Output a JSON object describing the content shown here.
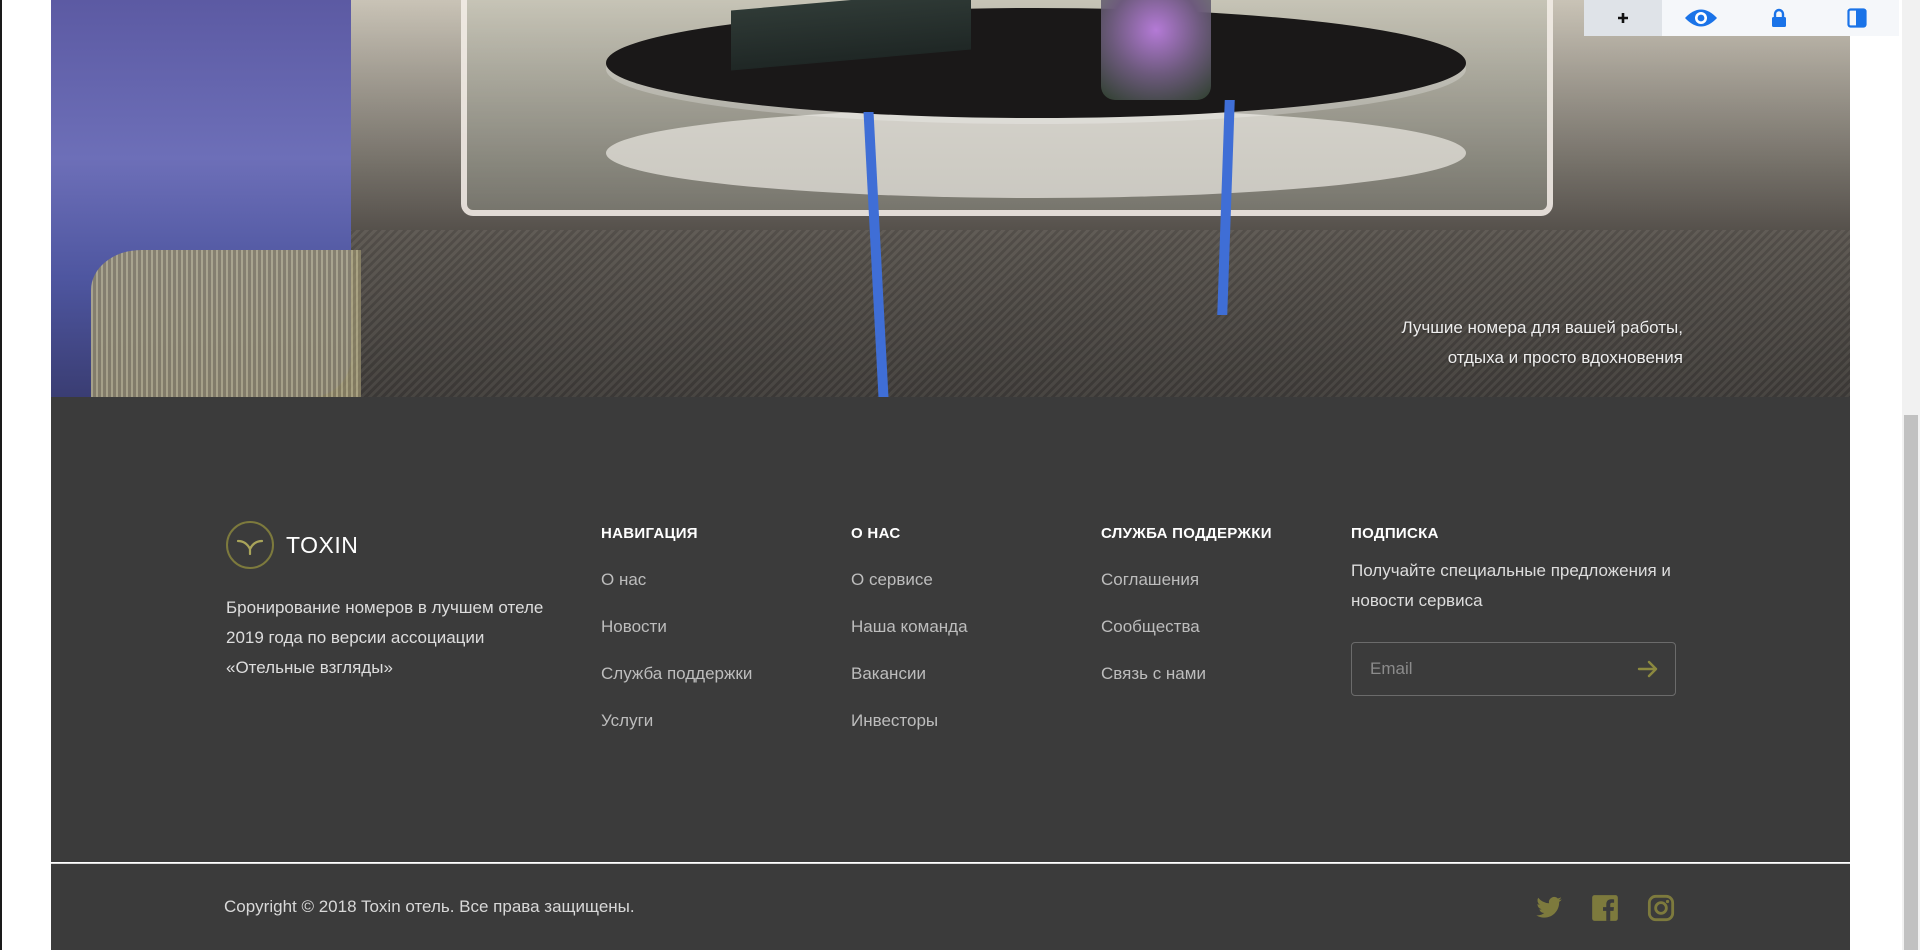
{
  "hero": {
    "caption_line1": "Лучшие номера для вашей работы,",
    "caption_line2": "отдыха и просто вдохновения"
  },
  "footer": {
    "brand": {
      "name": "TOXIN",
      "description": "Бронирование номеров в лучшем отеле 2019 года по версии ассоциации «Отельные взгляды»"
    },
    "columns": [
      {
        "title": "НАВИГАЦИЯ",
        "items": [
          "О нас",
          "Новости",
          "Служба поддержки",
          "Услуги"
        ]
      },
      {
        "title": "О НАС",
        "items": [
          "О сервисе",
          "Наша команда",
          "Вакансии",
          "Инвесторы"
        ]
      },
      {
        "title": "СЛУЖБА ПОДДЕРЖКИ",
        "items": [
          "Соглашения",
          "Сообщества",
          "Связь с нами"
        ]
      }
    ],
    "subscribe": {
      "title": "ПОДПИСКА",
      "text": "Получайте специальные предложения и новости сервиса",
      "email_placeholder": "Email",
      "submit_icon": "arrow-right-icon"
    },
    "copyright": "Copyright © 2018 Toxin отель. Все права защищены.",
    "social": [
      "twitter-icon",
      "facebook-icon",
      "instagram-icon"
    ]
  },
  "ext_toolbar": [
    "plus-icon",
    "eye-icon",
    "lock-icon",
    "panel-icon"
  ],
  "colors": {
    "footer_bg": "#3b3b3b",
    "accent_olive": "#7d7a3d",
    "toolbar_blue": "#1a73e8"
  }
}
